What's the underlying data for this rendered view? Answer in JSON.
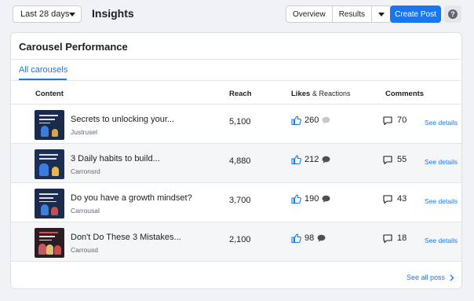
{
  "topbar": {
    "date_range": "Last 28 days",
    "title": "Insights",
    "overview": "Overview",
    "results": "Results",
    "create_post": "Create Post",
    "help": "?"
  },
  "card": {
    "title": "Carousel Performance",
    "tab": "All carousels",
    "headers": {
      "content": "Content",
      "reach": "Reach",
      "likes": "Likes",
      "likes_suffix": "& Reactions",
      "comments": "Comments"
    },
    "rows": [
      {
        "title": "Secrets to unlocking your...",
        "author": "Justrusel",
        "reach": "5,100",
        "likes": "260",
        "comments": "70",
        "details": "See details"
      },
      {
        "title": "3 Daily habits to build...",
        "author": "Carronsrd",
        "reach": "4,880",
        "likes": "212",
        "comments": "55",
        "details": "See details"
      },
      {
        "title": "Do you have a growth mindset?",
        "author": "Carrousal",
        "reach": "3,700",
        "likes": "190",
        "comments": "43",
        "details": "See details"
      },
      {
        "title": "Don't Do These 3 Mistakes...",
        "author": "Carrousd",
        "reach": "2,100",
        "likes": "98",
        "comments": "18",
        "details": "See details"
      }
    ],
    "see_all": "See all poss"
  },
  "colors": {
    "accent": "#1877f2",
    "thumb_bg": [
      "#1a2a4a",
      "#1b2f55",
      "#1a2b4d",
      "#2a1d24"
    ]
  }
}
